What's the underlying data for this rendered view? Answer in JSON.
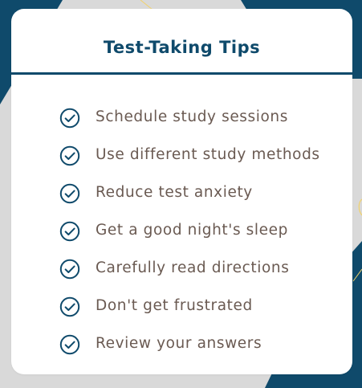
{
  "title": "Test-Taking Tips",
  "icon": "check-circle-icon",
  "colors": {
    "accent": "#0f4a6b",
    "text": "#6a5a52",
    "background": "#d9d9d9",
    "card": "#ffffff",
    "line_decoration": "#f2d26a"
  },
  "tips": [
    {
      "label": "Schedule study sessions"
    },
    {
      "label": "Use different study methods"
    },
    {
      "label": "Reduce test anxiety"
    },
    {
      "label": "Get a good night's sleep"
    },
    {
      "label": "Carefully read directions"
    },
    {
      "label": "Don't get frustrated"
    },
    {
      "label": "Review your answers"
    }
  ]
}
